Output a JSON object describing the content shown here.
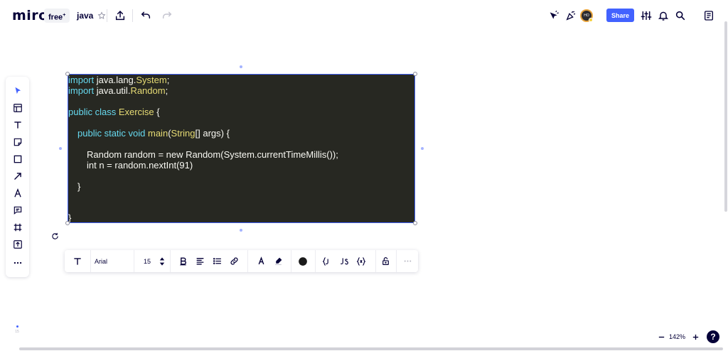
{
  "header": {
    "logo": "miro",
    "plan_badge": "free",
    "plan_badge_mark": "+",
    "board_title": "java",
    "share_label": "Share",
    "avatar_initials": "HO"
  },
  "code_block": {
    "lines": [
      {
        "segments": [
          {
            "text": "import ",
            "tone": "kw"
          },
          {
            "text": "java.lang.",
            "tone": "plain"
          },
          {
            "text": "System",
            "tone": "cls"
          },
          {
            "text": ";",
            "tone": "plain"
          }
        ]
      },
      {
        "segments": [
          {
            "text": "import ",
            "tone": "kw"
          },
          {
            "text": "java.util.",
            "tone": "plain"
          },
          {
            "text": "Random",
            "tone": "cls"
          },
          {
            "text": ";",
            "tone": "plain"
          }
        ]
      },
      {
        "segments": [
          {
            "text": "public class ",
            "tone": "kw"
          },
          {
            "text": "Exercise",
            "tone": "cls"
          },
          {
            "text": " {",
            "tone": "plain"
          }
        ]
      },
      {
        "segments": [
          {
            "text": "public static void ",
            "tone": "kw"
          },
          {
            "text": "main",
            "tone": "cls"
          },
          {
            "text": "(",
            "tone": "plain"
          },
          {
            "text": "String",
            "tone": "cls"
          },
          {
            "text": "[] args) {",
            "tone": "plain"
          }
        ]
      },
      {
        "segments": [
          {
            "text": "Random random = new Random(System.currentTimeMillis());",
            "tone": "plain"
          }
        ]
      },
      {
        "segments": [
          {
            "text": "int n = random.nextInt(91)",
            "tone": "plain"
          }
        ]
      },
      {
        "segments": [
          {
            "text": "}",
            "tone": "plain"
          }
        ]
      },
      {
        "segments": [
          {
            "text": "}",
            "tone": "plain"
          }
        ]
      }
    ]
  },
  "format_toolbar": {
    "font_family": "Arial",
    "font_size": "15"
  },
  "footer": {
    "zoom_level": "142%",
    "help_label": "?",
    "page_indicator": "15"
  },
  "colors": {
    "accent": "#4262ff",
    "code_background": "#272822",
    "keyword": "#66d9ef",
    "class_name": "#e6db74",
    "text": "#050038"
  },
  "icons": [
    "undo-icon",
    "redo-icon",
    "upload-icon",
    "star-icon",
    "cursor-icon",
    "reactions-icon",
    "settings-sliders-icon",
    "bell-icon",
    "search-icon",
    "notes-icon",
    "select-icon",
    "templates-icon",
    "text-icon",
    "sticky-note-icon",
    "shape-icon",
    "connector-icon",
    "pen-icon",
    "comment-icon",
    "frame-icon",
    "upload-tool-icon",
    "more-icon",
    "bold-icon",
    "align-icon",
    "list-icon",
    "link-icon",
    "text-color-icon",
    "highlight-icon",
    "color-dot-icon",
    "code-braces-icon",
    "code-js-icon",
    "code-fx-icon",
    "lock-icon",
    "rotate-icon",
    "zoom-out-icon",
    "zoom-in-icon"
  ]
}
